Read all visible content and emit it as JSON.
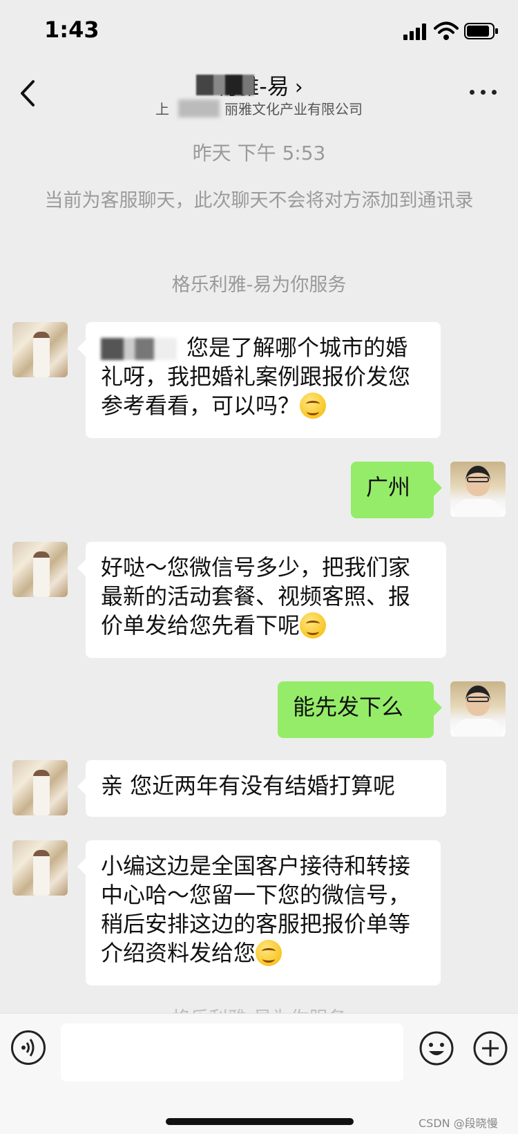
{
  "status_bar": {
    "time": "1:43"
  },
  "header": {
    "title": "利雅-易",
    "subtitle_prefix": "上",
    "subtitle_suffix": "丽雅文化产业有限公司",
    "back_icon": "chevron-left-icon",
    "more_icon": "ellipsis-icon"
  },
  "system": {
    "timestamp": "昨天 下午 5:53",
    "notice": "当前为客服聊天，此次聊天不会将对方添加到通讯录",
    "service": "格乐利雅-易为你服务"
  },
  "messages": [
    {
      "side": "in",
      "text": "您是了解哪个城市的婚礼呀，我把婚礼案例跟报价发您参考看看，可以吗？"
    },
    {
      "side": "out",
      "text": "广州"
    },
    {
      "side": "in",
      "text": "好哒～您微信号多少，把我们家最新的活动套餐、视频客照、报价单发给您先看下呢"
    },
    {
      "side": "out",
      "text": "能先发下么"
    },
    {
      "side": "in",
      "text": "亲 您近两年有没有结婚打算呢"
    },
    {
      "side": "in",
      "text": "小编这边是全国客户接待和转接中心哈～您留一下您的微信号，稍后安排这边的客服把报价单等介绍资料发给您"
    }
  ],
  "footer_fade": "格乐利雅-易为你服务",
  "input": {
    "placeholder": ""
  },
  "watermark": "CSDN @段晓慢",
  "colors": {
    "background": "#ededed",
    "outgoing_bubble": "#95ec69",
    "incoming_bubble": "#ffffff"
  }
}
